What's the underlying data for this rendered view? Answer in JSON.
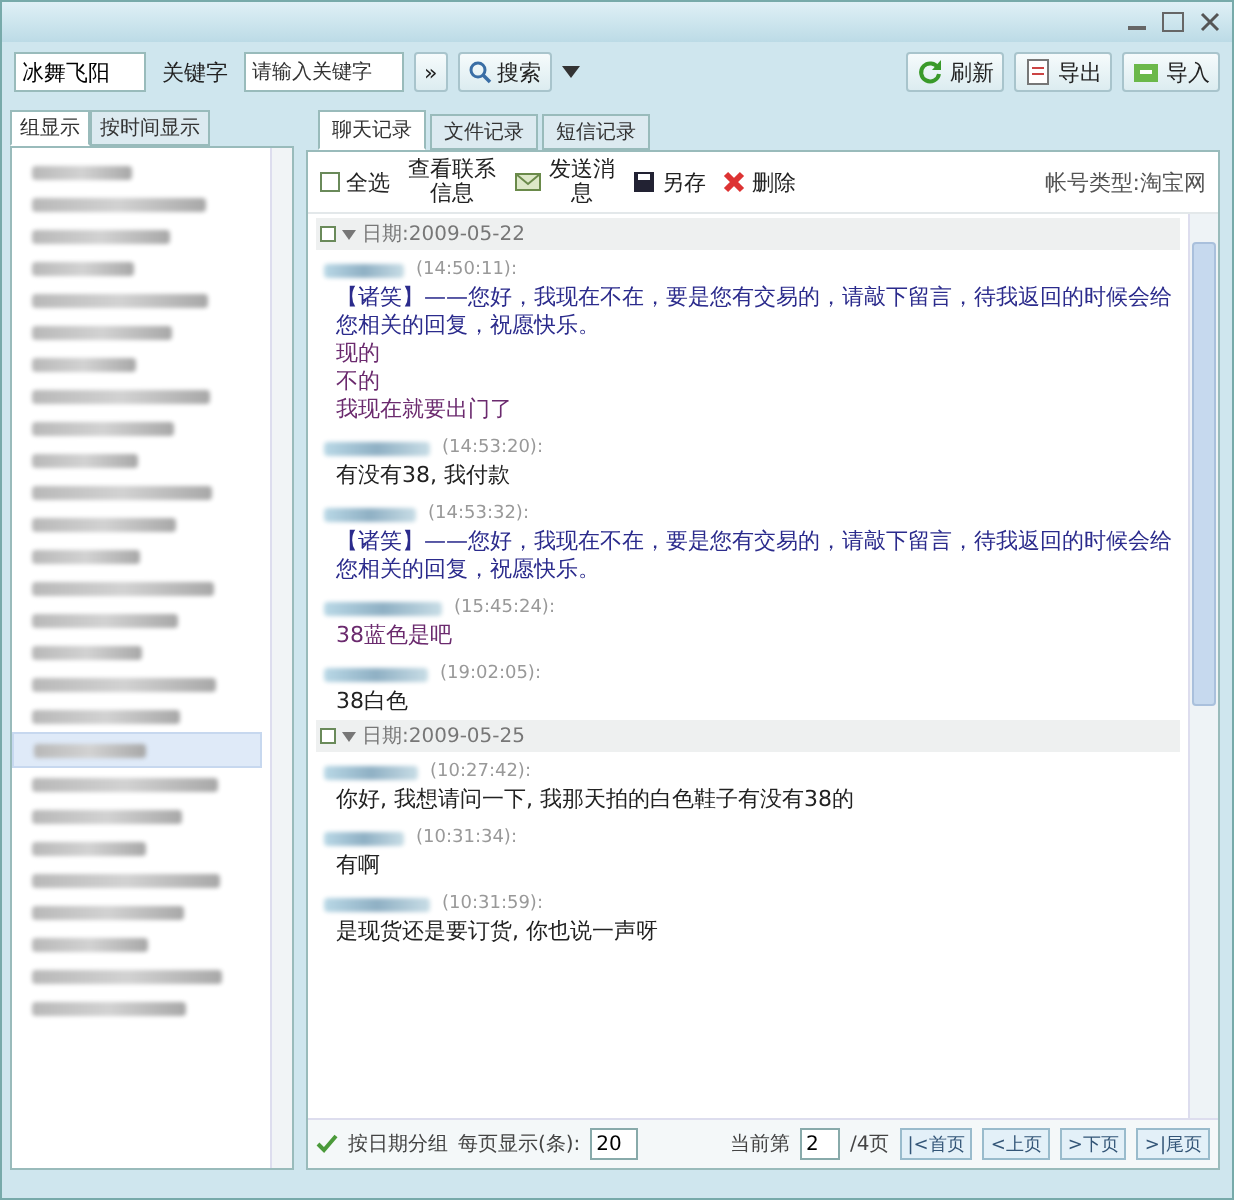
{
  "toolbar": {
    "account": "冰舞飞阳",
    "keyword_label": "关键字",
    "keyword_placeholder": "请输入关键字",
    "more_button": "»",
    "search_button": "搜索",
    "actions": [
      {
        "kind": "refresh",
        "label": "刷新"
      },
      {
        "kind": "export",
        "label": "导出"
      },
      {
        "kind": "import",
        "label": "导入"
      }
    ]
  },
  "sidebar": {
    "tabs": [
      {
        "label": "组显示",
        "selected": true
      },
      {
        "label": "按时间显示",
        "selected": false
      }
    ],
    "contacts": [
      {
        "selected": false
      },
      {
        "selected": false
      },
      {
        "selected": false
      },
      {
        "selected": false
      },
      {
        "selected": false
      },
      {
        "selected": false
      },
      {
        "selected": false
      },
      {
        "selected": false
      },
      {
        "selected": false
      },
      {
        "selected": false
      },
      {
        "selected": false
      },
      {
        "selected": false
      },
      {
        "selected": false
      },
      {
        "selected": false
      },
      {
        "selected": false
      },
      {
        "selected": false
      },
      {
        "selected": false
      },
      {
        "selected": false
      },
      {
        "selected": true
      },
      {
        "selected": false
      },
      {
        "selected": false
      },
      {
        "selected": false
      },
      {
        "selected": false
      },
      {
        "selected": false
      },
      {
        "selected": false
      },
      {
        "selected": false
      },
      {
        "selected": false
      }
    ]
  },
  "tabs": [
    {
      "label": "聊天记录",
      "selected": true
    },
    {
      "label": "文件记录",
      "selected": false
    },
    {
      "label": "短信记录",
      "selected": false
    }
  ],
  "actions": [
    {
      "kind": "select_all",
      "label": "全选"
    },
    {
      "kind": "contact_info",
      "label": "查看联系信息"
    },
    {
      "kind": "send",
      "label": "发送消息"
    },
    {
      "kind": "save",
      "label": "另存"
    },
    {
      "kind": "delete",
      "label": "删除"
    }
  ],
  "account_type": "帐号类型:淘宝网",
  "days": [
    {
      "date": "日期:2009-05-22",
      "messages": [
        {
          "time": "(14:50:11):",
          "lines": [
            {
              "text": "【诸笑】——您好，我现在不在，要是您有交易的，请敲下留言，待我返回的时候会给您相关的回复，祝愿快乐。",
              "color": "#2b2b8c"
            },
            {
              "text": "现的",
              "color": "#6b2a6e"
            },
            {
              "text": "不的",
              "color": "#6b2a6e"
            },
            {
              "text": "我现在就要出门了",
              "color": "#6b2a6e"
            }
          ]
        },
        {
          "time": "(14:53:20):",
          "lines": [
            {
              "text": "有没有38, 我付款",
              "color": "#222222"
            }
          ]
        },
        {
          "time": "(14:53:32):",
          "lines": [
            {
              "text": "【诸笑】——您好，我现在不在，要是您有交易的，请敲下留言，待我返回的时候会给您相关的回复，祝愿快乐。",
              "color": "#2b2b8c"
            }
          ]
        },
        {
          "time": "(15:45:24):",
          "lines": [
            {
              "text": "38蓝色是吧",
              "color": "#6b2a6e"
            }
          ]
        },
        {
          "time": "(19:02:05):",
          "lines": [
            {
              "text": "38白色",
              "color": "#222222"
            }
          ]
        }
      ]
    },
    {
      "date": "日期:2009-05-25",
      "messages": [
        {
          "time": "(10:27:42):",
          "lines": [
            {
              "text": "你好, 我想请问一下, 我那天拍的白色鞋子有没有38的",
              "color": "#222222"
            }
          ]
        },
        {
          "time": "(10:31:34):",
          "lines": [
            {
              "text": "有啊",
              "color": "#222222"
            }
          ]
        },
        {
          "time": "(10:31:59):",
          "lines": [
            {
              "text": "是现货还是要订货, 你也说一声呀",
              "color": "#222222"
            }
          ]
        }
      ]
    }
  ],
  "pager": {
    "group_by_date": {
      "label": "按日期分组",
      "checked": true
    },
    "per_page_label": "每页显示(条):",
    "per_page": "20",
    "current_label": "当前第",
    "current": "2",
    "total": "/4页",
    "buttons": [
      "|<首页",
      "<上页",
      ">下页",
      ">|尾页"
    ]
  }
}
